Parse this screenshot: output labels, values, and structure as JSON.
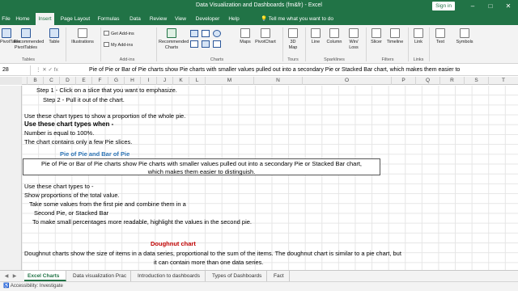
{
  "window": {
    "title": "Data Visualization and Dashboards (fm&fr) - Excel",
    "signin": "Sign in",
    "controls": [
      "–",
      "□",
      "✕"
    ]
  },
  "tabs": [
    "File",
    "Home",
    "Insert",
    "Page Layout",
    "Formulas",
    "Data",
    "Review",
    "View",
    "Developer",
    "Help"
  ],
  "active_tab": "Insert",
  "tell_me": "Tell me what you want to do",
  "ribbon": {
    "tables": {
      "buttons": [
        "PivotTable",
        "Recommended PivotTables",
        "Table"
      ],
      "group": "Tables"
    },
    "illustrations": {
      "label": "Illustrations"
    },
    "addins": {
      "items": [
        "Get Add-ins",
        "My Add-ins"
      ],
      "group": "Add-ins"
    },
    "charts": {
      "recommended": "Recommended Charts",
      "maps": "Maps",
      "pivotchart": "PivotChart",
      "group": "Charts"
    },
    "tours": {
      "button": "3D Map",
      "group": "Tours"
    },
    "sparklines": {
      "buttons": [
        "Line",
        "Column",
        "Win/ Loss"
      ],
      "group": "Sparklines"
    },
    "filters": {
      "buttons": [
        "Slicer",
        "Timeline"
      ],
      "group": "Filters"
    },
    "links": {
      "button": "Link",
      "group": "Links"
    },
    "text": {
      "button": "Text"
    },
    "symbols": {
      "button": "Symbols"
    }
  },
  "formula_bar": {
    "name_box": "28",
    "fx_icons": "⋮  ✕  ✓  fx",
    "content": "Pie of Pie or Bar of Pie charts show Pie charts with smaller values pulled out into a secondary Pie or Stacked Bar chart, which makes them easier to"
  },
  "columns": [
    "B",
    "C",
    "D",
    "E",
    "F",
    "G",
    "H",
    "I",
    "J",
    "K",
    "L",
    "M",
    "N",
    "O",
    "P",
    "Q",
    "R",
    "S",
    "T"
  ],
  "sheet": {
    "step1": "Step 1 - Click on a slice that you want to emphasize.",
    "step2": "Step 2 - Pull it out of the chart.",
    "use_line": "Use these chart types to show a proportion of the whole pie.",
    "when_heading": "Use these chart types when -",
    "when_1": "Number is equal to 100%.",
    "when_2": "The chart contains only a few Pie slices.",
    "pie_heading": "Pie of Pie and Bar of Pie",
    "pie_box_1": "Pie of Pie or Bar of Pie charts show Pie charts with smaller values pulled out into a secondary Pie or Stacked Bar chart,",
    "pie_box_2": "which makes them easier to distinguish.",
    "use_to": "Use these chart types to -",
    "show_prop": "Show proportions of the total value.",
    "take_values": "Take some values from the first pie and combine them in a",
    "second_pie": "Second Pie, or Stacked Bar",
    "small_pct": "To make small percentages more readable, highlight the values in the second pie.",
    "doughnut_heading": "Doughnut chart",
    "doughnut_1": "Doughnut charts show the size of items in a data series, proportional to the sum of the items. The doughnut chart is similar to a pie chart, but",
    "doughnut_2": "it can contain more than one data series."
  },
  "sheet_tabs": [
    "Excel Charts",
    "Data visualization Prac",
    "Introduction to dashboards",
    "Types of Dashboards",
    "Fact"
  ],
  "active_sheet": "Excel Charts",
  "status": "Accessibility: Investigate"
}
